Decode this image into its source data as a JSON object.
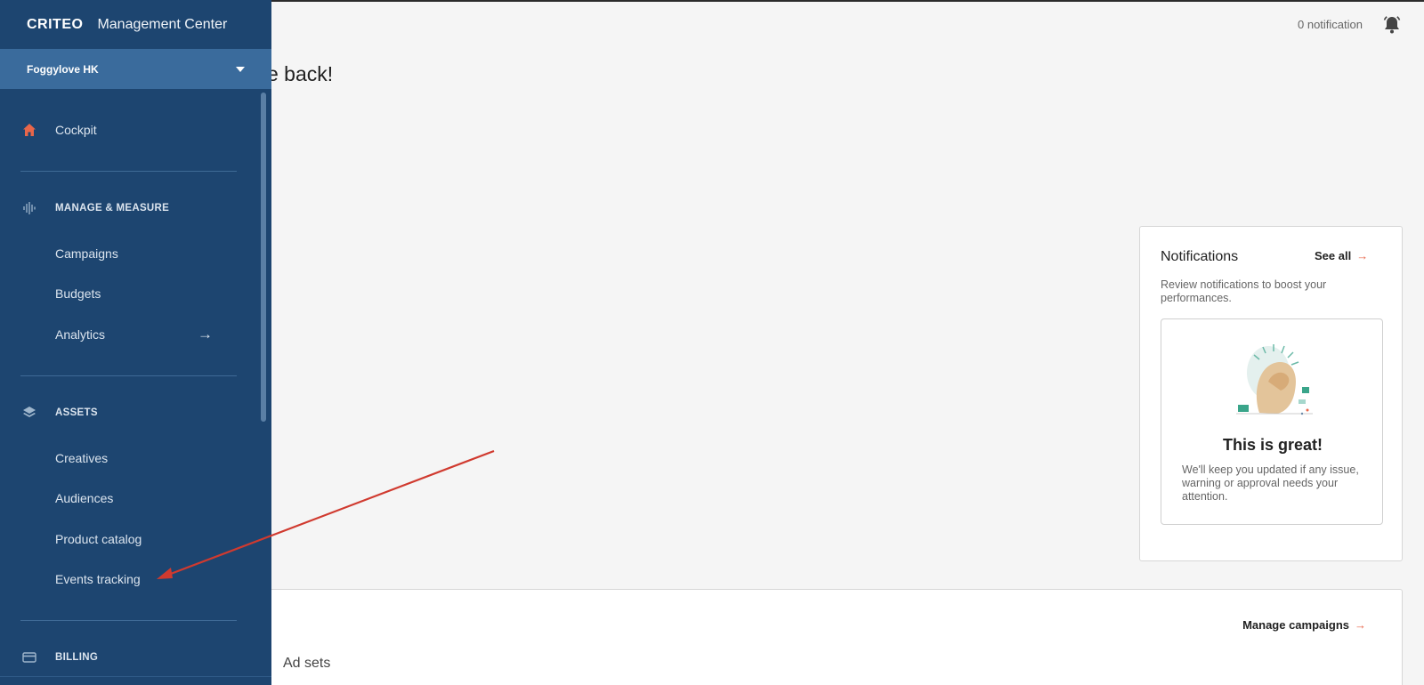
{
  "header": {
    "notification_count": "0 notification",
    "welcome_text": "e back!"
  },
  "sidebar": {
    "logo": "CRITEO",
    "app_title": "Management Center",
    "account_name": "Foggylove HK",
    "cockpit": "Cockpit",
    "manage_measure": {
      "title": "MANAGE & MEASURE",
      "items": [
        "Campaigns",
        "Budgets",
        "Analytics"
      ]
    },
    "assets": {
      "title": "ASSETS",
      "items": [
        "Creatives",
        "Audiences",
        "Product catalog",
        "Events tracking"
      ]
    },
    "billing": "BILLING"
  },
  "notifications": {
    "title": "Notifications",
    "see_all": "See all",
    "description": "Review notifications to boost your performances.",
    "empty_title": "This is great!",
    "empty_text": "We'll keep you updated if any issue, warning or approval needs your attention."
  },
  "campaigns": {
    "manage_link": "Manage campaigns",
    "tab_adsets": "Ad sets"
  },
  "colors": {
    "sidebar_bg": "#1d4570",
    "account_bg": "#3a6b9c",
    "accent": "#e8664a",
    "annotation_arrow": "#d03a2f"
  },
  "icons": {
    "home": "home-icon",
    "manage": "waveform-icon",
    "assets": "layers-icon",
    "billing": "credit-card-icon",
    "bell": "bell-icon"
  }
}
